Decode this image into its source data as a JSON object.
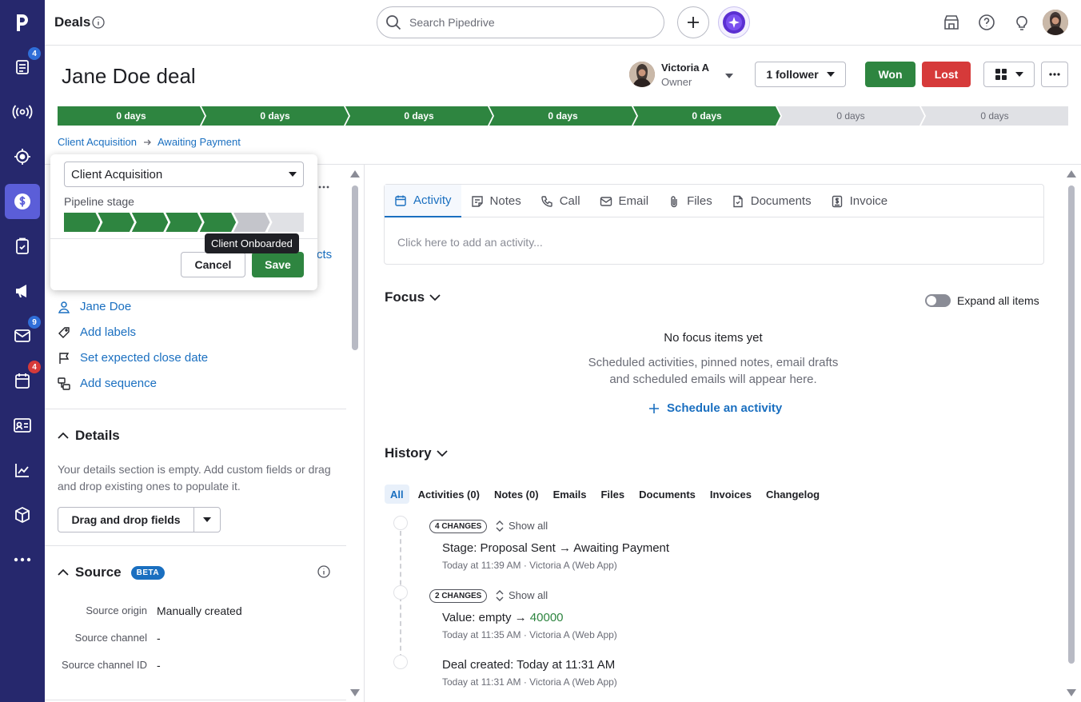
{
  "topbar": {
    "title": "Deals",
    "search_placeholder": "Search Pipedrive"
  },
  "sidebar": {
    "logo": "p",
    "items": [
      {
        "icon": "leads-icon",
        "badge": "4",
        "badge_color": "#2f6ed8"
      },
      {
        "icon": "campaign-broadcast-icon"
      },
      {
        "icon": "target-icon"
      },
      {
        "icon": "dollar-icon",
        "active": true
      },
      {
        "icon": "clipboard-icon"
      },
      {
        "icon": "megaphone-icon"
      },
      {
        "icon": "mail-icon",
        "badge": "9",
        "badge_color": "#2f6ed8"
      },
      {
        "icon": "calendar-icon",
        "badge": "4",
        "badge_color": "#d63a3a"
      },
      {
        "icon": "contacts-card-icon"
      },
      {
        "icon": "insights-chart-icon"
      },
      {
        "icon": "products-box-icon"
      },
      {
        "icon": "more-icon"
      }
    ]
  },
  "deal": {
    "title": "Jane Doe deal",
    "owner_name": "Victoria A",
    "owner_role": "Owner",
    "follower_label": "1 follower",
    "won_label": "Won",
    "lost_label": "Lost"
  },
  "pipeline": {
    "stages": [
      {
        "label": "0 days",
        "done": true
      },
      {
        "label": "0 days",
        "done": true
      },
      {
        "label": "0 days",
        "done": true
      },
      {
        "label": "0 days",
        "done": true
      },
      {
        "label": "0 days",
        "done": true
      },
      {
        "label": "0 days",
        "done": false
      },
      {
        "label": "0 days",
        "done": false
      }
    ]
  },
  "breadcrumb": {
    "pipeline": "Client Acquisition",
    "stage": "Awaiting Payment"
  },
  "popover": {
    "pipeline_select": "Client Acquisition",
    "stage_label": "Pipeline stage",
    "tooltip": "Client Onboarded",
    "cancel_label": "Cancel",
    "save_label": "Save"
  },
  "left": {
    "partial_link": "cts",
    "person": "Jane Doe",
    "add_labels": "Add labels",
    "close_date": "Set expected close date",
    "sequence": "Add sequence",
    "details_title": "Details",
    "details_empty": "Your details section is empty. Add custom fields or drag and drop existing ones to populate it.",
    "drag_drop_label": "Drag and drop fields",
    "source_title": "Source",
    "source_badge": "BETA",
    "source_rows": [
      {
        "label": "Source origin",
        "value": "Manually created"
      },
      {
        "label": "Source channel",
        "value": "-"
      },
      {
        "label": "Source channel ID",
        "value": "-"
      }
    ]
  },
  "composer": {
    "tabs": [
      {
        "label": "Activity",
        "icon": "calendar-icon",
        "active": true
      },
      {
        "label": "Notes",
        "icon": "note-icon"
      },
      {
        "label": "Call",
        "icon": "phone-icon"
      },
      {
        "label": "Email",
        "icon": "mail-icon"
      },
      {
        "label": "Files",
        "icon": "paperclip-icon"
      },
      {
        "label": "Documents",
        "icon": "document-icon"
      },
      {
        "label": "Invoice",
        "icon": "invoice-icon"
      }
    ],
    "placeholder": "Click here to add an activity..."
  },
  "focus": {
    "title": "Focus",
    "expand_label": "Expand all items",
    "empty_title": "No focus items yet",
    "empty_line1": "Scheduled activities, pinned notes, email drafts",
    "empty_line2": "and scheduled emails will appear here.",
    "schedule_label": "Schedule an activity"
  },
  "history": {
    "title": "History",
    "filters": [
      "All",
      "Activities (0)",
      "Notes (0)",
      "Emails",
      "Files",
      "Documents",
      "Invoices",
      "Changelog"
    ],
    "show_all": "Show all",
    "entries": [
      {
        "chip": "4 CHANGES",
        "field": "Stage",
        "text": "Proposal Sent → Awaiting Payment",
        "meta": "Today at 11:39 AM · Victoria A (Web App)"
      },
      {
        "chip": "2 CHANGES",
        "field": "Value",
        "text_prefix": "empty → ",
        "highlight": "40000",
        "meta": "Today at 11:35 AM · Victoria A (Web App)"
      },
      {
        "field": "Deal created",
        "text": "Today at 11:31 AM",
        "meta": "Today at 11:31 AM · Victoria A (Web App)"
      }
    ]
  },
  "colors": {
    "sidebar": "#26286d",
    "green": "#2e8540",
    "red": "#d63a3a",
    "link": "#1a6fc0"
  }
}
